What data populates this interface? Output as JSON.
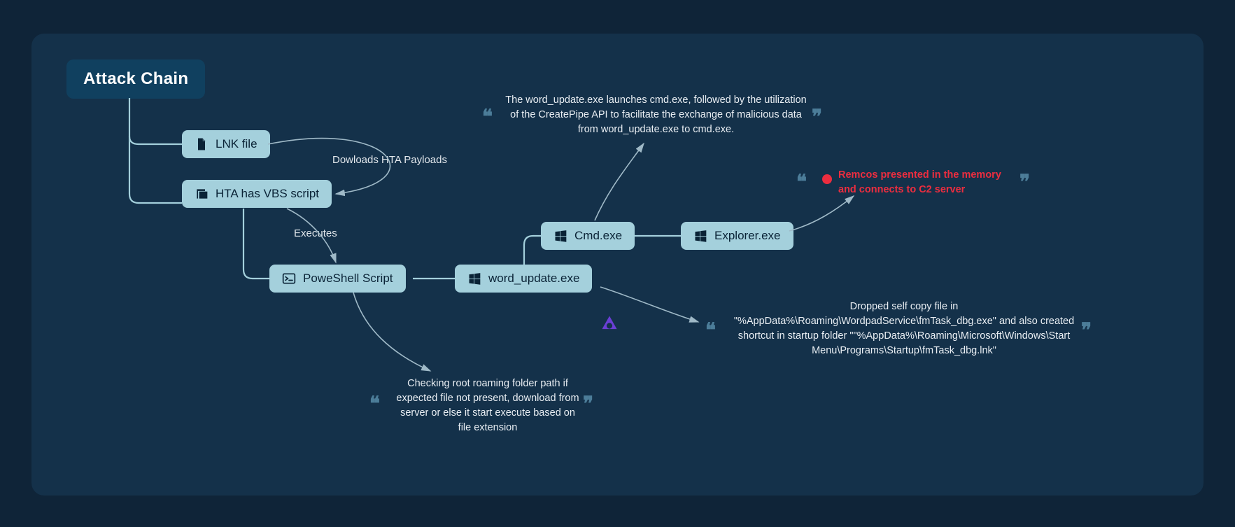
{
  "title": "Attack Chain",
  "nodes": {
    "lnk": "LNK file",
    "hta": "HTA has VBS script",
    "ps": "PoweShell Script",
    "wu": "word_update.exe",
    "cmd": "Cmd.exe",
    "explorer": "Explorer.exe"
  },
  "edges": {
    "download": "Dowloads HTA Payloads",
    "executes": "Executes"
  },
  "notes": {
    "cmd_note": "The word_update.exe launches cmd.exe, followed by the utilization of the CreatePipe API to facilitate the exchange of malicious data from word_update.exe to cmd.exe.",
    "remcos": "Remcos presented in the memory and connects to C2 server",
    "ps_note": "Checking root roaming folder path if expected file not present, download from server or else it start execute based on file extension",
    "drop_note": "Dropped self copy file in \"%AppData%\\Roaming\\WordpadService\\fmTask_dbg.exe\" and also created shortcut in startup folder \"\"%AppData%\\Roaming\\Microsoft\\Windows\\Start Menu\\Programs\\Startup\\fmTask_dbg.lnk\""
  },
  "colors": {
    "panel": "#14314a",
    "node_bg": "#a4d0dc",
    "accent": "#ec2d3f"
  }
}
